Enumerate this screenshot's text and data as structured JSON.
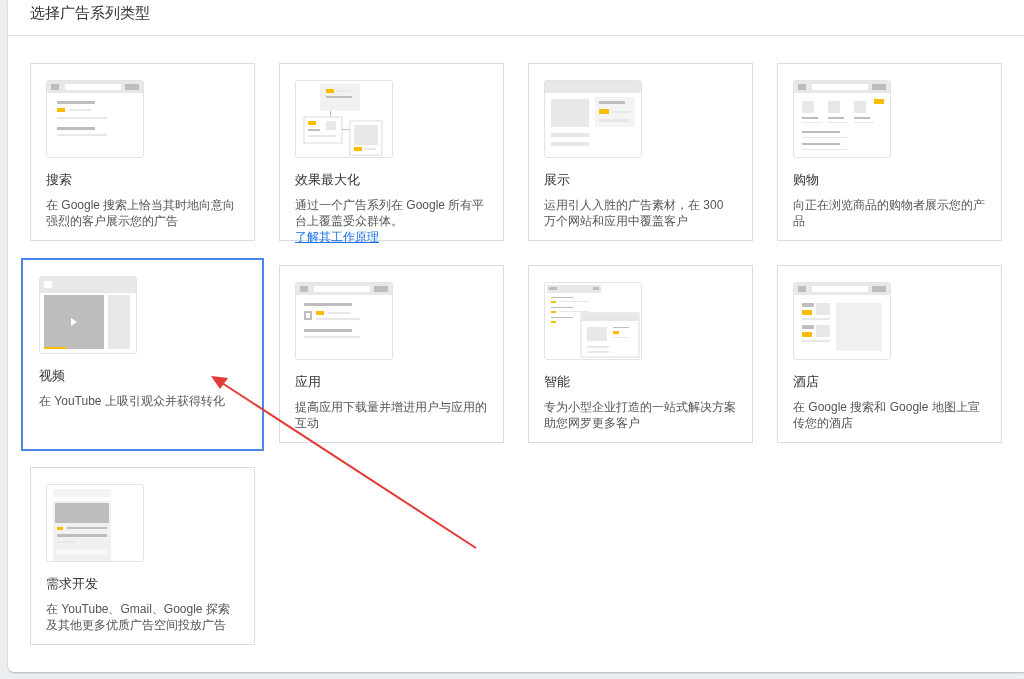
{
  "header": {
    "title": "选择广告系列类型"
  },
  "campaign_types": [
    {
      "kind": "search",
      "title": "搜索",
      "description": "在 Google 搜索上恰当其时地向意向强烈的客户展示您的广告",
      "selected": false
    },
    {
      "kind": "performance",
      "title": "效果最大化",
      "description": "通过一个广告系列在 Google 所有平台上覆盖受众群体。",
      "link": "了解其工作原理",
      "selected": false
    },
    {
      "kind": "display",
      "title": "展示",
      "description": "运用引人入胜的广告素材，在 300 万个网站和应用中覆盖客户",
      "selected": false
    },
    {
      "kind": "shopping",
      "title": "购物",
      "description": "向正在浏览商品的购物者展示您的产品",
      "selected": false
    },
    {
      "kind": "video",
      "title": "视频",
      "description": "在 YouTube 上吸引观众并获得转化",
      "selected": true
    },
    {
      "kind": "app",
      "title": "应用",
      "description": "提高应用下载量并增进用户与应用的互动",
      "selected": false
    },
    {
      "kind": "smart",
      "title": "智能",
      "description": "专为小型企业打造的一站式解决方案助您网罗更多客户",
      "selected": false
    },
    {
      "kind": "hotel",
      "title": "酒店",
      "description": "在 Google 搜索和 Google 地图上宣传您的酒店",
      "selected": false
    },
    {
      "kind": "discovery",
      "title": "需求开发",
      "description": "在 YouTube、Gmail、Google 探索及其他更多优质广告空间投放广告",
      "selected": false
    }
  ]
}
